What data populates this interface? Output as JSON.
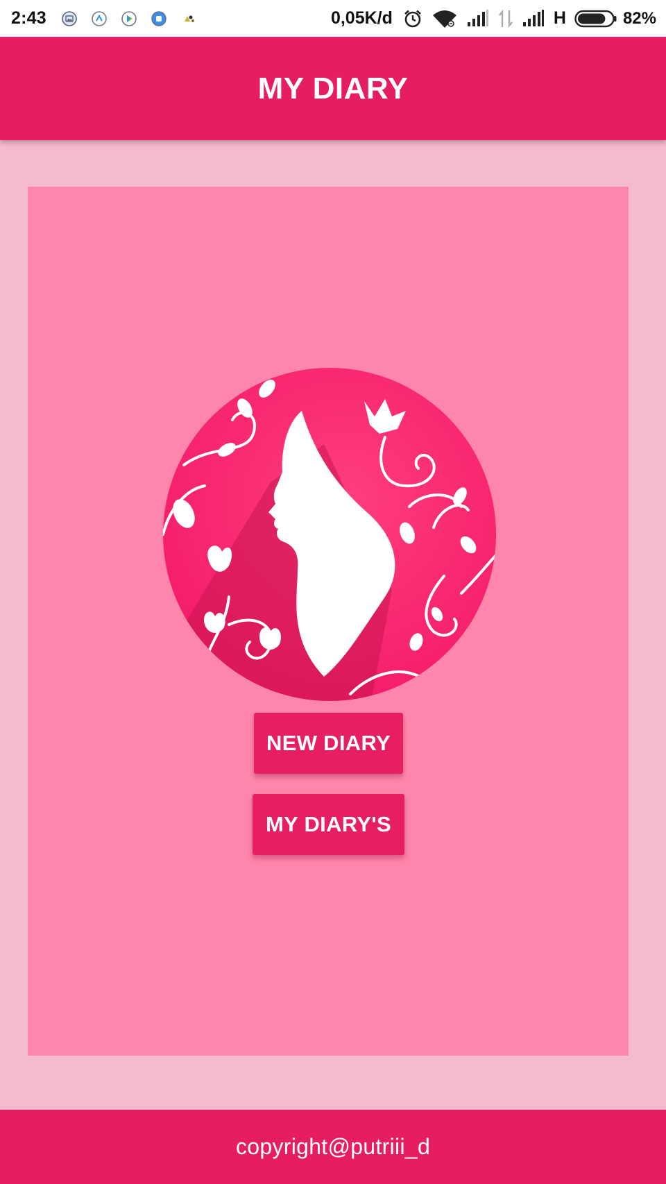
{
  "status_bar": {
    "time": "2:43",
    "notification_icons": [
      "gallery-icon",
      "navigation-icon",
      "play-store-icon",
      "app-icon",
      "game-icon"
    ],
    "network_speed": "0,05K/d",
    "network_type": "H",
    "battery_percent": "82%",
    "battery_level": 0.82
  },
  "app_bar": {
    "title": "MY DIARY"
  },
  "main": {
    "logo_icon": "woman-silhouette-logo",
    "new_diary_label": "NEW DIARY",
    "my_diaries_label": "MY DIARY'S"
  },
  "footer": {
    "copyright": "copyright@putriii_d"
  },
  "colors": {
    "primary": "#e61e61",
    "page_background": "#f5bace",
    "panel_background": "#fe85ab",
    "status_bar_background": "#ffffff"
  }
}
